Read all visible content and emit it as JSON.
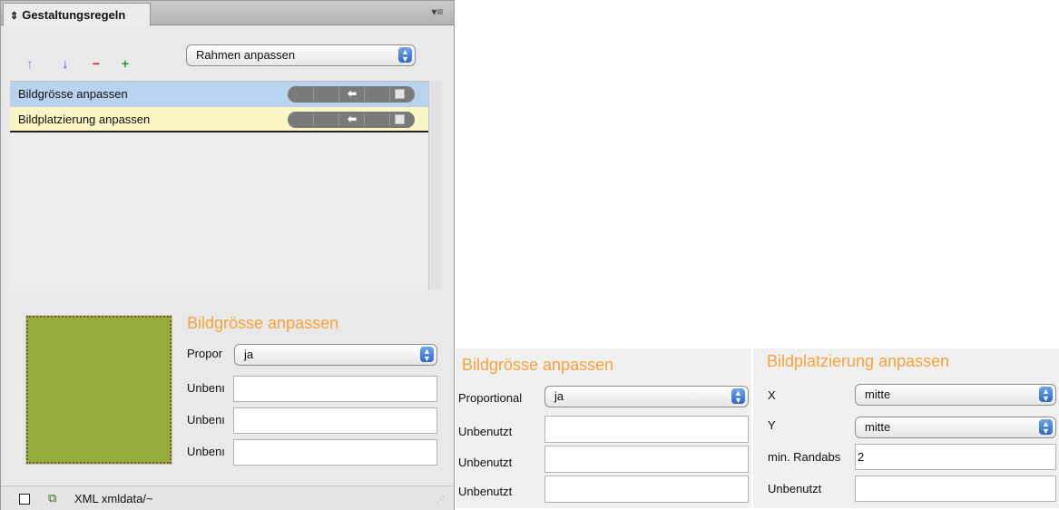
{
  "panel": {
    "tab_label": "Gestaltungsregeln",
    "tab_arrows_icon": "updown-arrows-icon",
    "menu_icon": "panel-menu-icon",
    "toolbar": {
      "buttons": [
        {
          "name": "move-up-button",
          "glyph": "↑",
          "color": "#7f7fd0"
        },
        {
          "name": "move-down-button",
          "glyph": "↓",
          "color": "#3a3ab8"
        },
        {
          "name": "remove-button",
          "glyph": "−",
          "color": "#d0202a"
        },
        {
          "name": "add-button",
          "glyph": "+",
          "color": "#1a9a2a"
        }
      ],
      "dropdown_value": "Rahmen anpassen"
    },
    "rules": [
      {
        "label": "Bildgrösse anpassen",
        "bg": "#b9d3ef"
      },
      {
        "label": "Bildplatzierung anpassen",
        "bg": "#fbf4c4"
      }
    ],
    "props": {
      "heading": "Bildgrösse anpassen",
      "rows": [
        {
          "label": "Propor",
          "value": "ja",
          "type": "select"
        },
        {
          "label": "Unbenı",
          "value": "",
          "type": "text"
        },
        {
          "label": "Unbenı",
          "value": "",
          "type": "text"
        },
        {
          "label": "Unbenı",
          "value": "",
          "type": "text"
        }
      ]
    },
    "footer": {
      "text": "XML xmldata/~"
    }
  },
  "snippet_size": {
    "heading": "Bildgrösse anpassen",
    "rows": [
      {
        "label": "Proportional",
        "value": "ja",
        "type": "select"
      },
      {
        "label": "Unbenutzt",
        "value": "",
        "type": "text"
      },
      {
        "label": "Unbenutzt",
        "value": "",
        "type": "text"
      },
      {
        "label": "Unbenutzt",
        "value": "",
        "type": "text"
      }
    ]
  },
  "snippet_place": {
    "heading": "Bildplatzierung anpassen",
    "rows": [
      {
        "label": "X",
        "value": "mitte",
        "type": "select"
      },
      {
        "label": "Y",
        "value": "mitte",
        "type": "select"
      },
      {
        "label": "min. Randabs",
        "value": "2",
        "type": "text"
      },
      {
        "label": "Unbenutzt",
        "value": "",
        "type": "text"
      }
    ]
  },
  "colors": {
    "accent_heading": "#f7a23a",
    "preview_fill": "#95ae3b"
  }
}
